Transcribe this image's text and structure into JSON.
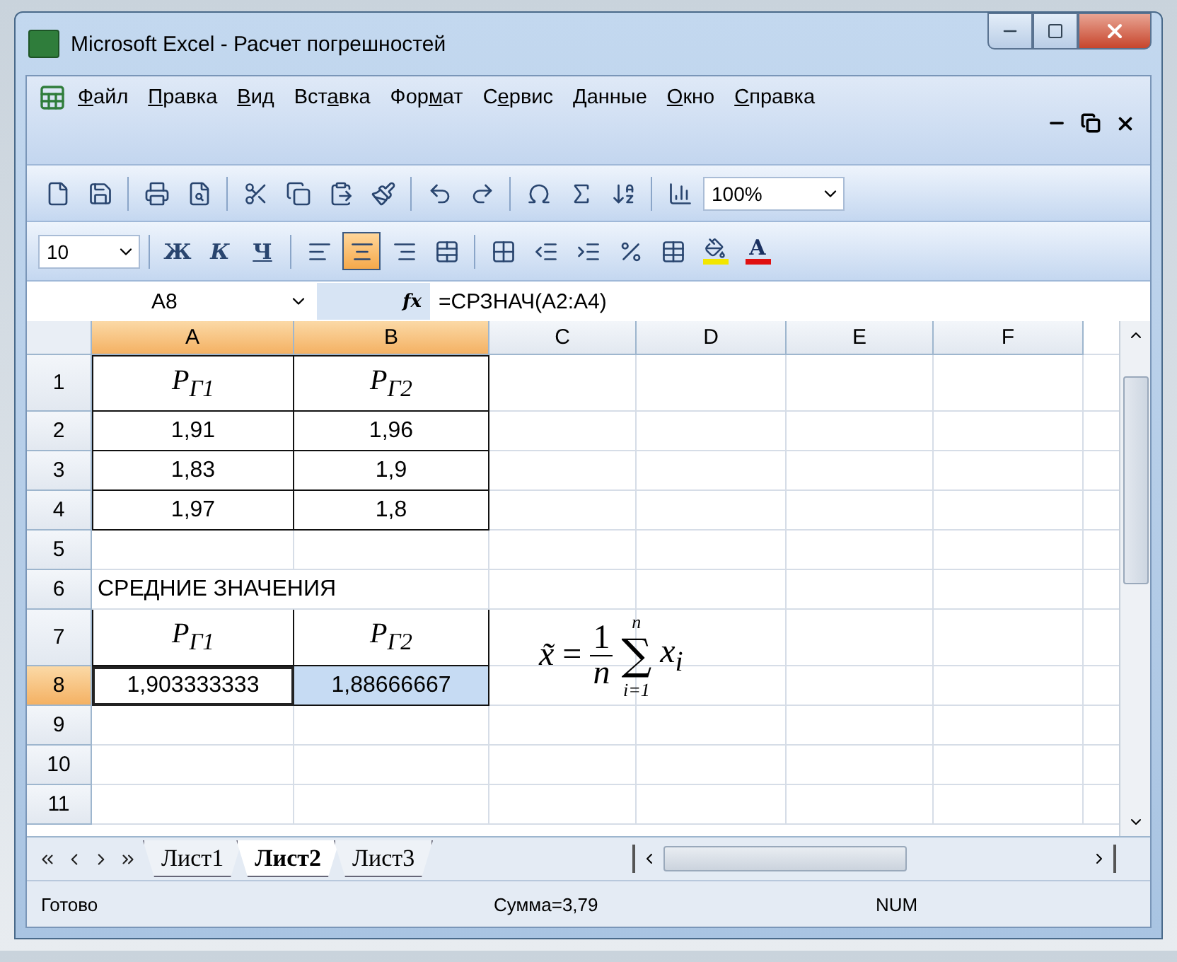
{
  "window": {
    "title": "Microsoft Excel - Расчет погрешностей"
  },
  "menu": [
    {
      "key": "Ф",
      "post": "айл"
    },
    {
      "key": "П",
      "post": "равка"
    },
    {
      "key": "В",
      "post": "ид"
    },
    {
      "pre": "Вст",
      "key": "а",
      "post": "вка"
    },
    {
      "pre": "Фор",
      "key": "м",
      "post": "ат"
    },
    {
      "pre": "С",
      "key": "е",
      "post": "рвис"
    },
    {
      "key": "Д",
      "post": "анные"
    },
    {
      "key": "О",
      "post": "кно"
    },
    {
      "key": "С",
      "post": "правка"
    }
  ],
  "standard_toolbar": {
    "zoom": "100%"
  },
  "format_toolbar": {
    "font_size": "10",
    "bold": "Ж",
    "italic": "К",
    "underline": "Ч",
    "align": [
      {
        "selected": false
      },
      {
        "selected": true
      },
      {
        "selected": false
      }
    ],
    "font_color": "A"
  },
  "formula_bar": {
    "name_box": "A8",
    "fx": "fx",
    "formula": "=СРЗНАЧ(A2:A4)"
  },
  "columns": [
    {
      "label": "A",
      "selected": true
    },
    {
      "label": "B",
      "selected": true
    },
    {
      "label": "C",
      "selected": false
    },
    {
      "label": "D",
      "selected": false
    },
    {
      "label": "E",
      "selected": false
    },
    {
      "label": "F",
      "selected": false
    }
  ],
  "rows": [
    {
      "header": "1",
      "selected": false,
      "cells": [
        {
          "kind": "symbol",
          "text": "P$_{Г1}$",
          "bordered": true,
          "selected": false,
          "active": false
        },
        {
          "kind": "symbol",
          "text": "P$_{Г2}$",
          "bordered": true,
          "selected": false,
          "active": false
        }
      ]
    },
    {
      "header": "2",
      "selected": false,
      "cells": [
        {
          "kind": "number",
          "text": "1,91",
          "bordered": true,
          "selected": false,
          "active": false
        },
        {
          "kind": "number",
          "text": "1,96",
          "bordered": true,
          "selected": false,
          "active": false
        }
      ]
    },
    {
      "header": "3",
      "selected": false,
      "cells": [
        {
          "kind": "number",
          "text": "1,83",
          "bordered": true,
          "selected": false,
          "active": false
        },
        {
          "kind": "number",
          "text": "1,9",
          "bordered": true,
          "selected": false,
          "active": false
        }
      ]
    },
    {
      "header": "4",
      "selected": false,
      "cells": [
        {
          "kind": "number",
          "text": "1,97",
          "bordered": true,
          "selected": false,
          "active": false
        },
        {
          "kind": "number",
          "text": "1,8",
          "bordered": true,
          "selected": false,
          "active": false
        }
      ]
    },
    {
      "header": "5",
      "selected": false,
      "cells": []
    },
    {
      "header": "6",
      "selected": false,
      "cells": [
        {
          "kind": "label",
          "text": "СРЕДНИЕ ЗНАЧЕНИЯ",
          "bordered": false,
          "selected": false,
          "active": false
        }
      ]
    },
    {
      "header": "7",
      "selected": false,
      "cells": [
        {
          "kind": "symbol",
          "text": "P$_{Г1}$",
          "bordered": true,
          "selected": false,
          "active": false
        },
        {
          "kind": "symbol",
          "text": "P$_{Г2}$",
          "bordered": true,
          "selected": false,
          "active": false
        }
      ]
    },
    {
      "header": "8",
      "selected": true,
      "cells": [
        {
          "kind": "number",
          "text": "1,903333333",
          "bordered": true,
          "selected": false,
          "active": true
        },
        {
          "kind": "number",
          "text": "1,88666667",
          "bordered": true,
          "selected": true,
          "active": false
        }
      ]
    },
    {
      "header": "9",
      "selected": false,
      "cells": []
    },
    {
      "header": "10",
      "selected": false,
      "cells": []
    },
    {
      "header": "11",
      "selected": false,
      "cells": []
    }
  ],
  "equation": {
    "lhs": "x̃",
    "equals": "=",
    "numerator": "1",
    "denominator": "n",
    "sum_upper": "n",
    "sigma": "∑",
    "sum_lower": "i=1",
    "term": "x$_{i}$"
  },
  "sheet_tabs": [
    {
      "label": "Лист1",
      "selected": false
    },
    {
      "label": "Лист2",
      "selected": true
    },
    {
      "label": "Лист3",
      "selected": false
    }
  ],
  "status_bar": {
    "state": "Готово",
    "sum": "Сумма=3,79",
    "num": "NUM"
  }
}
